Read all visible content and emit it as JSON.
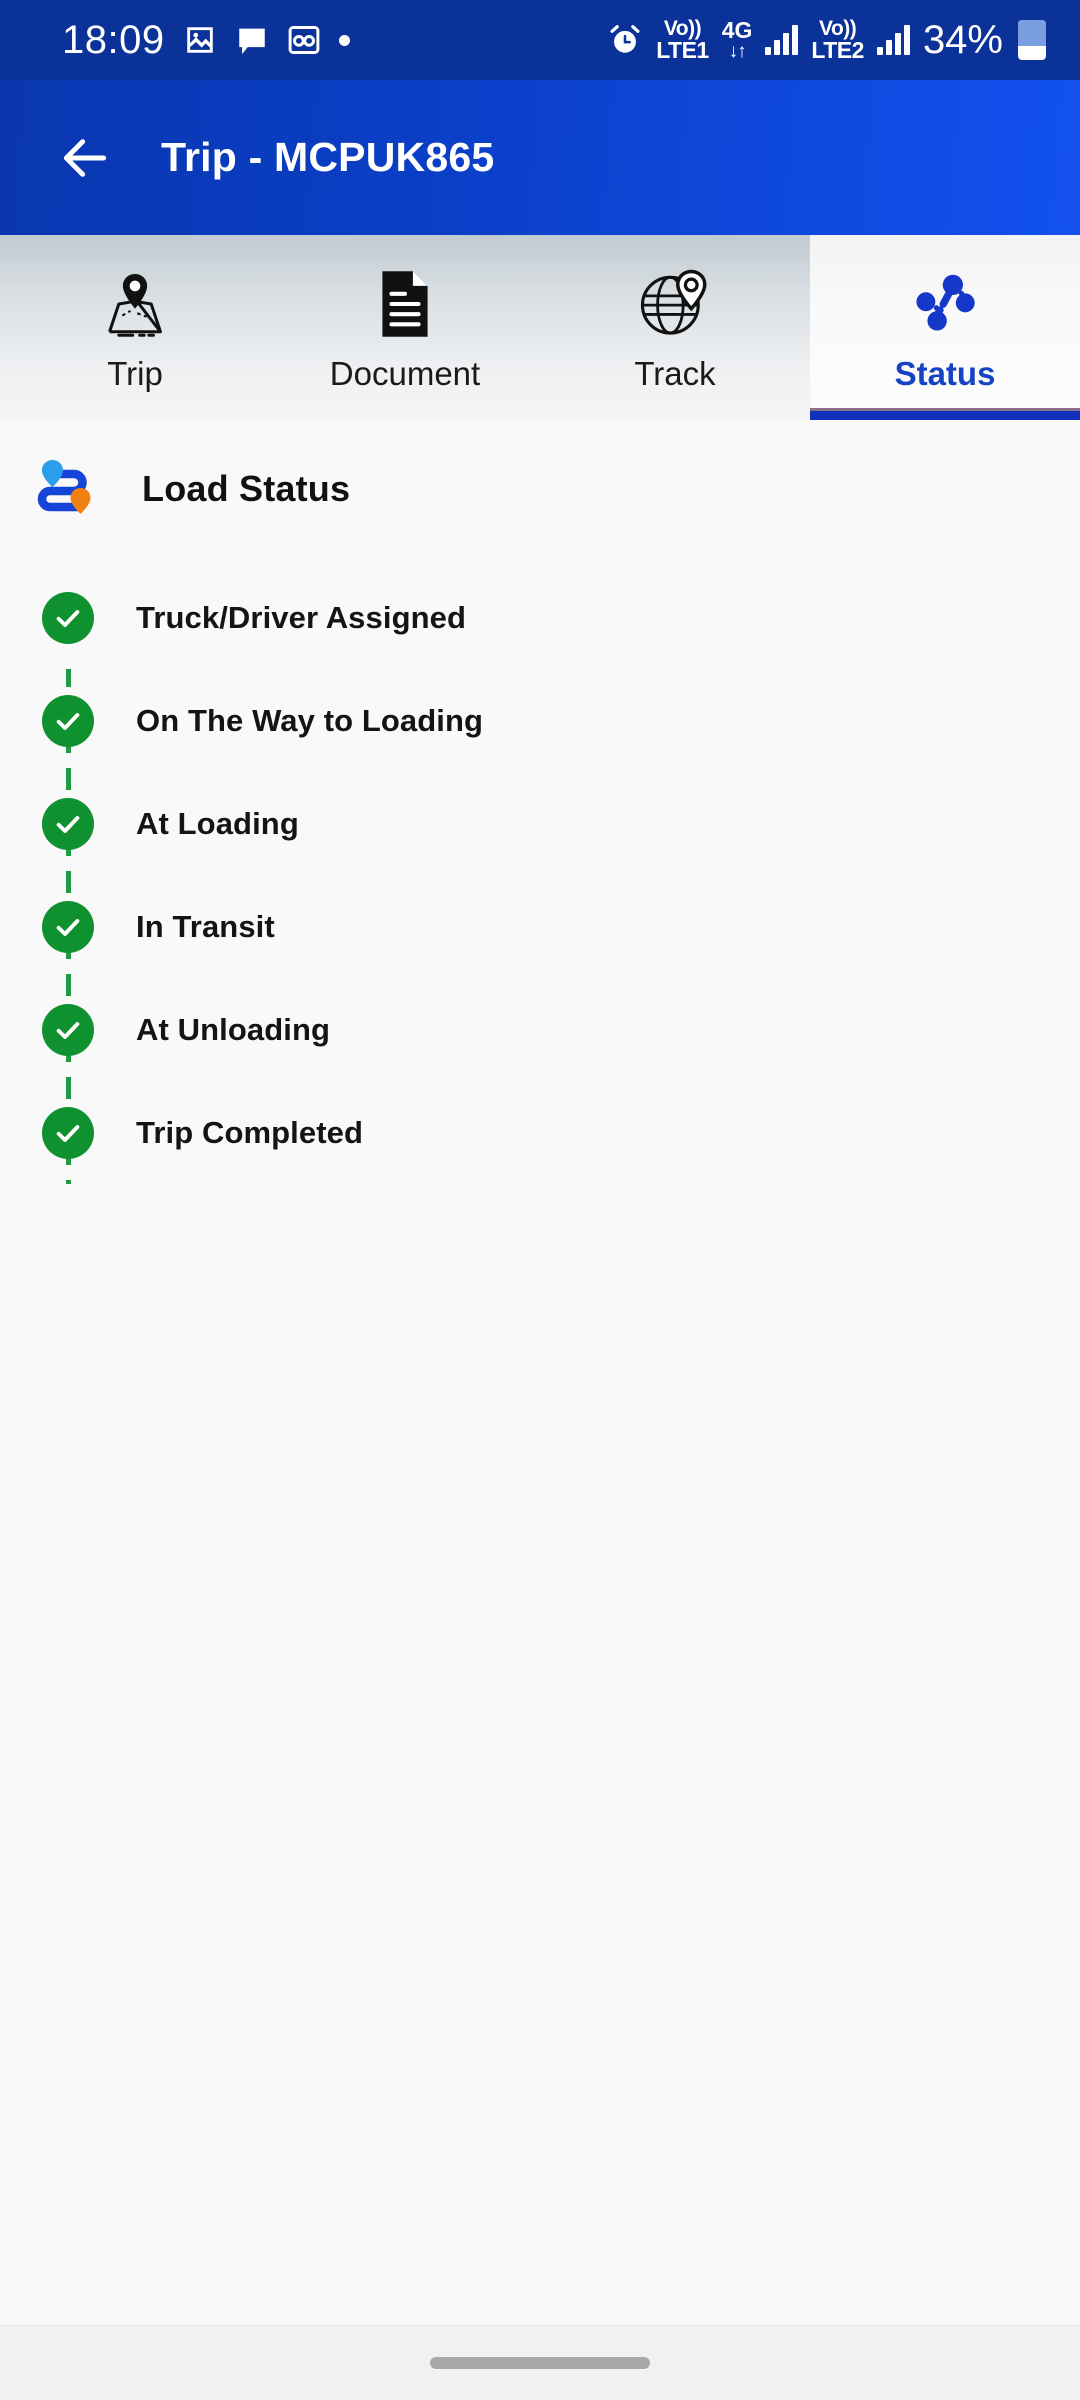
{
  "status_bar": {
    "clock": "18:09",
    "left_icons": [
      "image-icon",
      "message-icon",
      "voicemail-icon",
      "dot-indicator"
    ],
    "alarm_icon": "alarm-icon",
    "sim1_volte_top": "Vo))",
    "sim1_volte_bottom": "LTE1",
    "network_type": "4G",
    "data_arrows": "↓↑",
    "sim2_volte_top": "Vo))",
    "sim2_volte_bottom": "LTE2",
    "battery_percent": "34%",
    "bg_color": "#0b3299"
  },
  "app_bar": {
    "back_icon": "back-arrow-icon",
    "title": "Trip - MCPUK865",
    "gradient_from": "#0a37b0",
    "gradient_to": "#1351ef"
  },
  "tabs": [
    {
      "id": "trip",
      "label": "Trip",
      "icon": "map-pin-icon",
      "active": false
    },
    {
      "id": "document",
      "label": "Document",
      "icon": "document-icon",
      "active": false
    },
    {
      "id": "track",
      "label": "Track",
      "icon": "globe-pin-icon",
      "active": false
    },
    {
      "id": "status",
      "label": "Status",
      "icon": "status-nodes-icon",
      "active": true
    }
  ],
  "main": {
    "section_icon": "route-pins-icon",
    "section_title": "Load Status",
    "accent_color": "#1543c4",
    "completed_color": "#0f9130",
    "steps": [
      {
        "label": "Truck/Driver Assigned",
        "state": "completed"
      },
      {
        "label": "On The Way to Loading",
        "state": "completed"
      },
      {
        "label": "At Loading",
        "state": "completed"
      },
      {
        "label": "In Transit",
        "state": "completed"
      },
      {
        "label": "At Unloading",
        "state": "completed"
      },
      {
        "label": "Trip Completed",
        "state": "completed"
      }
    ]
  },
  "nav_bar": {
    "home_indicator": "home-indicator-pill"
  }
}
